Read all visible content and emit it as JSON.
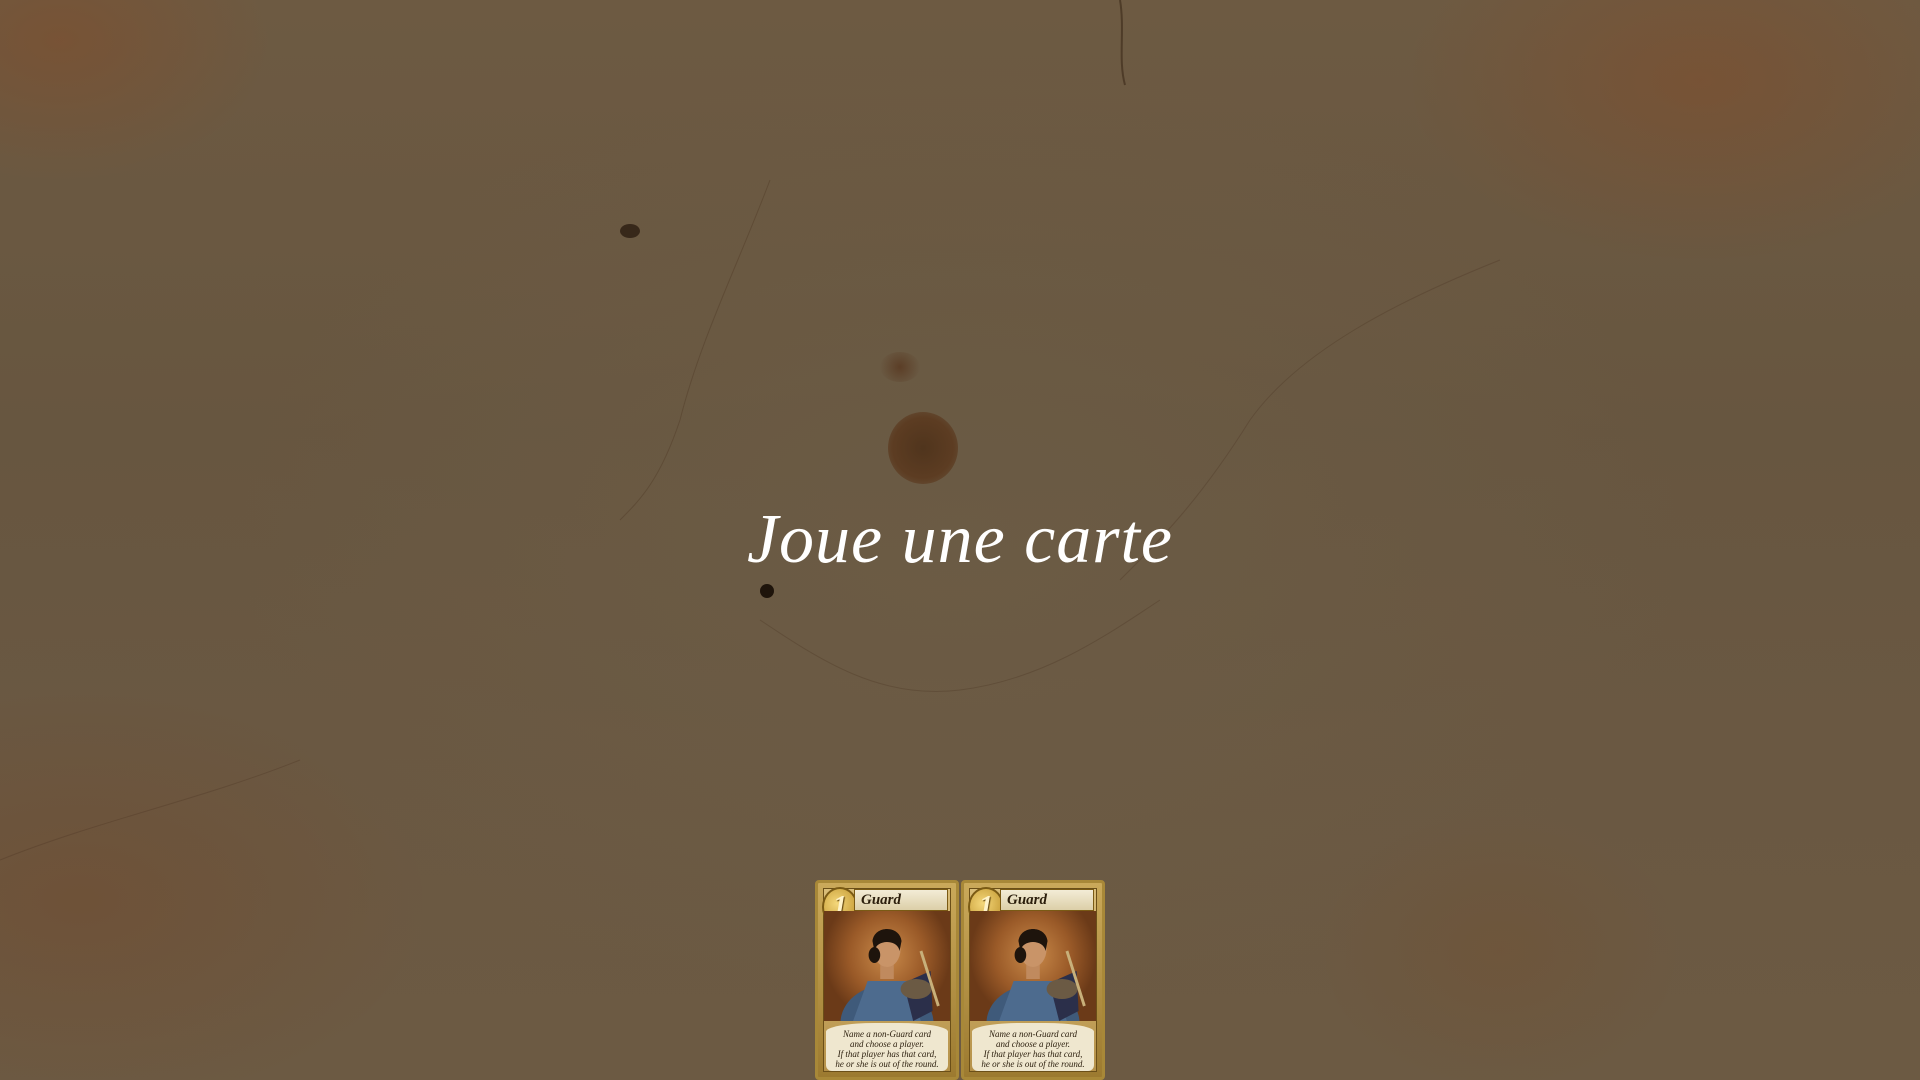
{
  "game": {
    "prompt": "Joue une carte",
    "hand": [
      {
        "name": "Guard",
        "value": "1",
        "text": [
          "Name a non-Guard card",
          "and choose a player.",
          "If that player has that card,",
          "he or she is out of the round."
        ]
      },
      {
        "name": "Guard",
        "value": "1",
        "text": [
          "Name a non-Guard card",
          "and choose a player.",
          "If that player has that card,",
          "he or she is out of the round."
        ]
      }
    ]
  },
  "colors": {
    "table_background": "#6a5842",
    "prompt_text": "#ffffff",
    "card_frame": "#a88838"
  }
}
